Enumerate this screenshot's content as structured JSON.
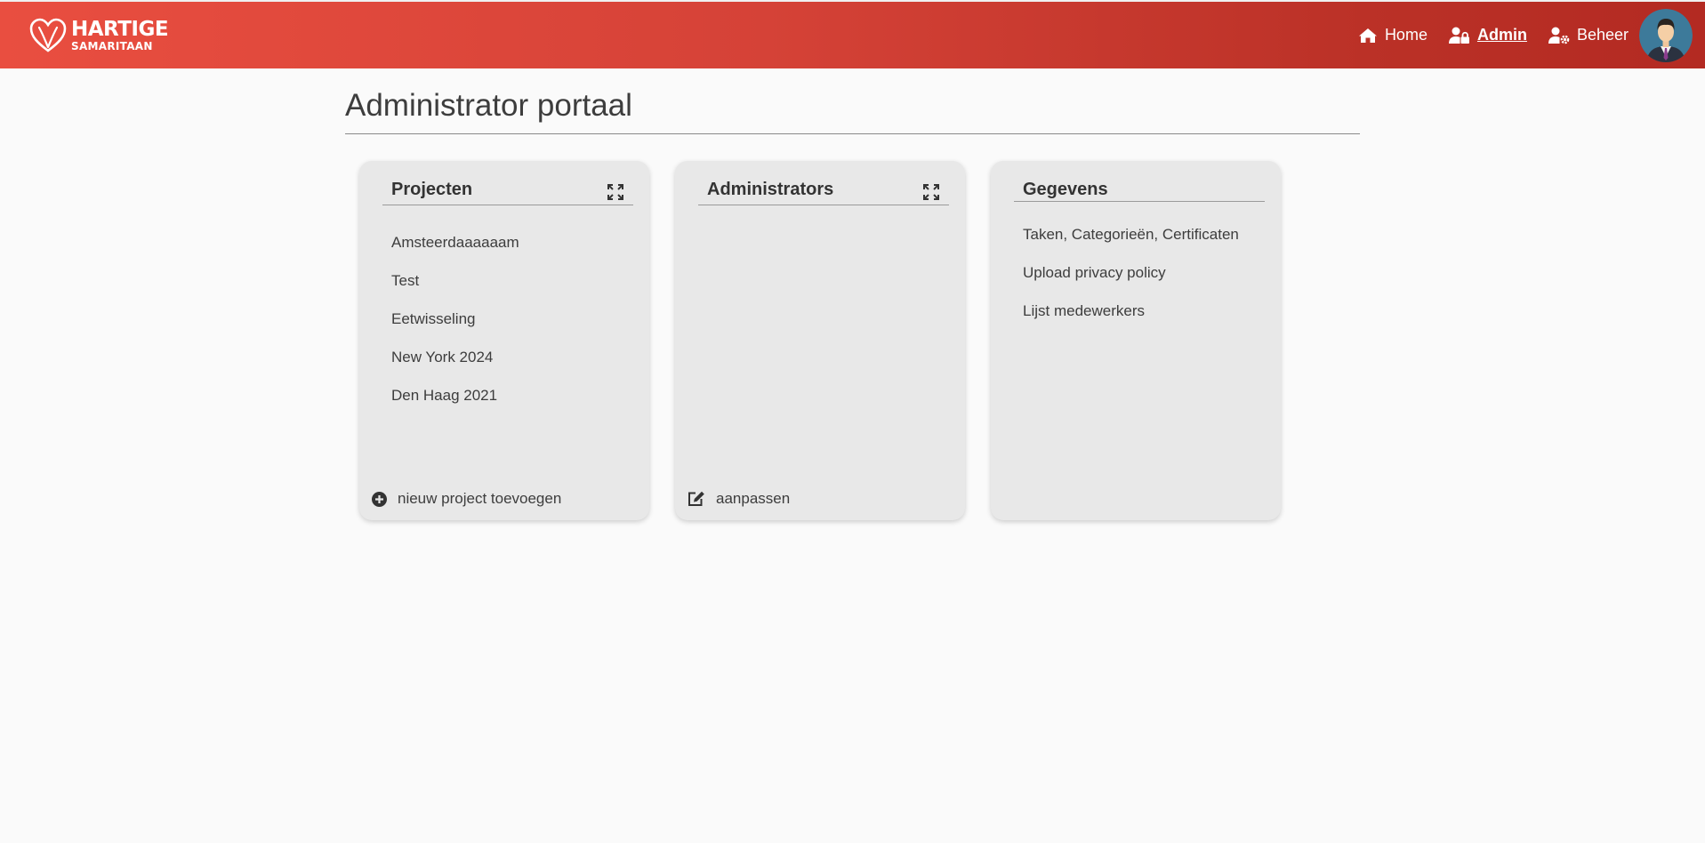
{
  "brand": {
    "name_line1": "HARTIGE",
    "name_line2": "SAMARITAAN",
    "accent": "#e94e40",
    "accent_dark": "#b32a22"
  },
  "nav": {
    "items": [
      {
        "label": "Home",
        "icon": "home-icon",
        "active": false
      },
      {
        "label": "Admin",
        "icon": "user-lock-icon",
        "active": true
      },
      {
        "label": "Beheer",
        "icon": "user-cog-icon",
        "active": false
      }
    ],
    "avatar_icon": "user-avatar"
  },
  "page": {
    "title": "Administrator portaal"
  },
  "cards": {
    "projecten": {
      "title": "Projecten",
      "items": [
        "Amsteerdaaaaaam",
        "Test",
        "Eetwisseling",
        "New York 2024",
        "Den Haag 2021"
      ],
      "footer_label": "nieuw project toevoegen",
      "footer_icon": "plus-circle-icon"
    },
    "administrators": {
      "title": "Administrators",
      "items": [],
      "footer_label": "aanpassen",
      "footer_icon": "edit-icon"
    },
    "gegevens": {
      "title": "Gegevens",
      "items": [
        "Taken, Categorieën, Certificaten",
        "Upload privacy policy",
        "Lijst medewerkers"
      ]
    }
  }
}
